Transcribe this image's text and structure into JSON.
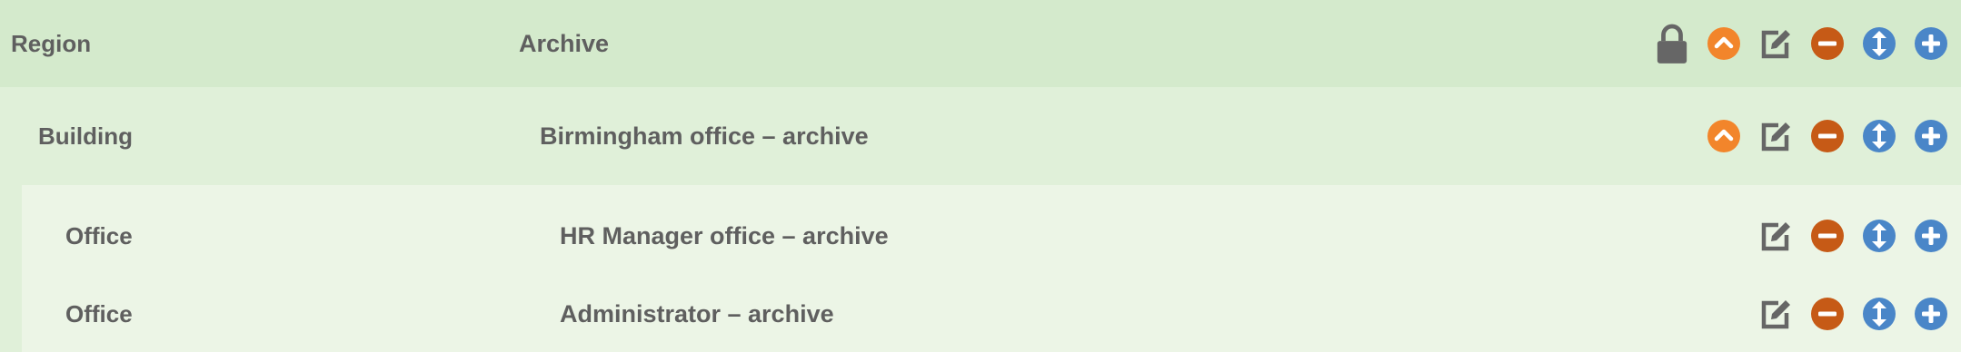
{
  "colors": {
    "level0_bg": "#d4eacc",
    "level1_bg": "#e0f0d9",
    "level2_bg": "#ecf5e6",
    "text": "#5f5f5f",
    "collapse_orange": "#f2852b",
    "remove_darkorange": "#c65a16",
    "move_blue": "#4a86c8",
    "add_blue": "#4a86c8",
    "edit_gray": "#666666",
    "lock_gray": "#666666"
  },
  "rows": [
    {
      "type": "Region",
      "name": "Archive",
      "icons": [
        "lock-icon",
        "collapse-icon",
        "edit-icon",
        "remove-icon",
        "move-icon",
        "add-icon"
      ]
    },
    {
      "type": "Building",
      "name": "Birmingham office – archive",
      "icons": [
        "collapse-icon",
        "edit-icon",
        "remove-icon",
        "move-icon",
        "add-icon"
      ]
    },
    {
      "type": "Office",
      "name": "HR Manager office – archive",
      "icons": [
        "edit-icon",
        "remove-icon",
        "move-icon",
        "add-icon"
      ]
    },
    {
      "type": "Office",
      "name": "Administrator – archive",
      "icons": [
        "edit-icon",
        "remove-icon",
        "move-icon",
        "add-icon"
      ]
    }
  ]
}
